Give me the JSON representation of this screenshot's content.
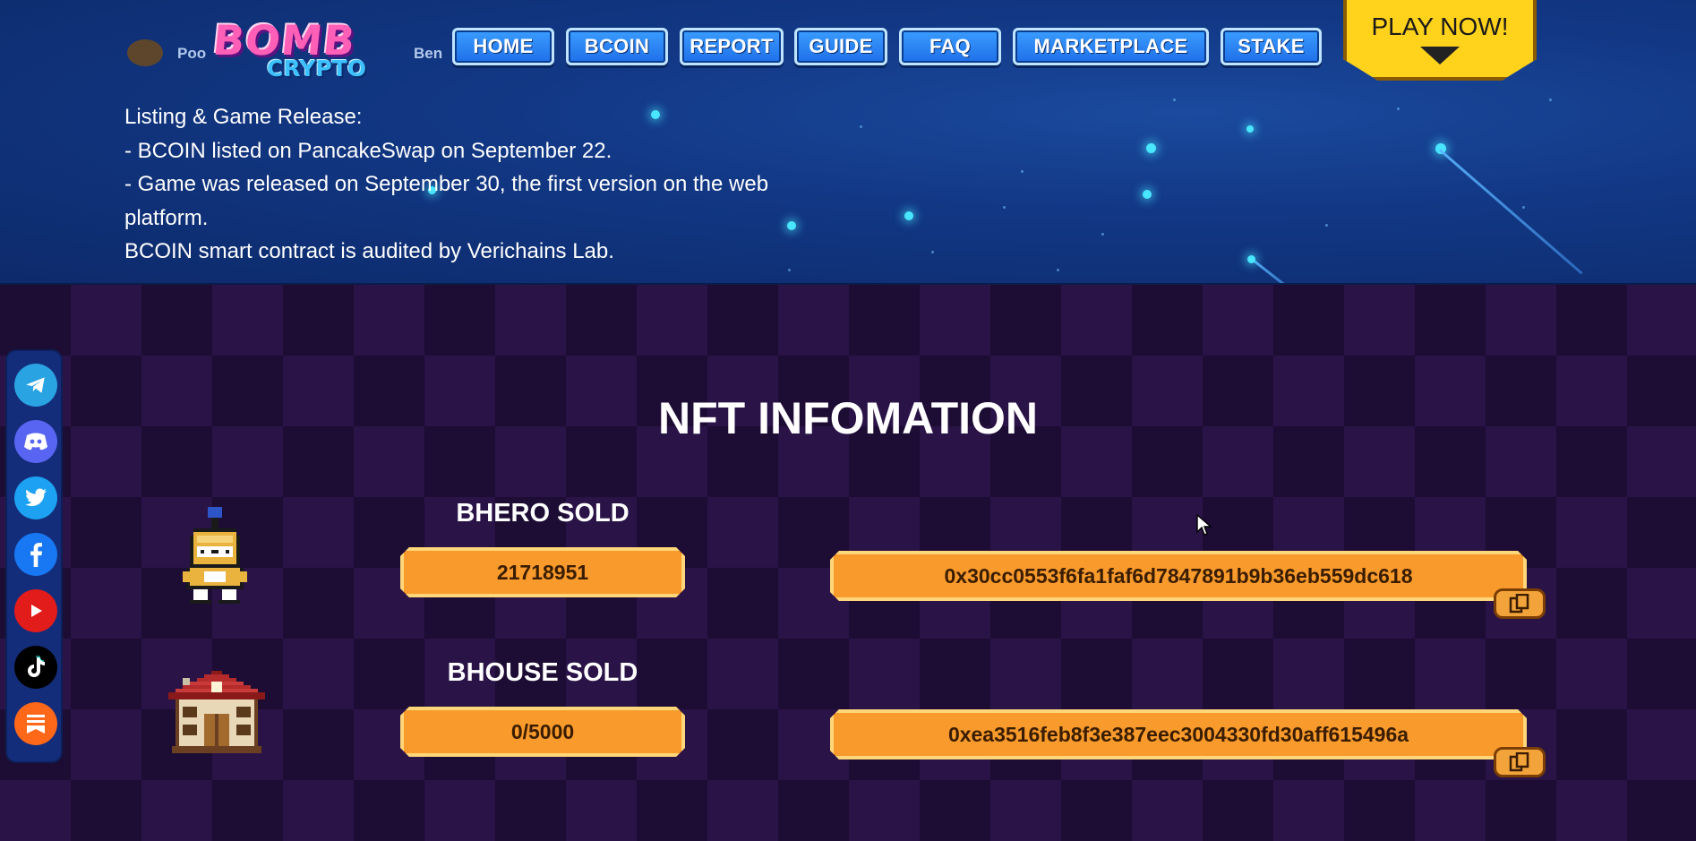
{
  "header": {
    "logo": {
      "line1": "BOMB",
      "line2": "CRYPTO"
    },
    "partial_behind_logo": [
      "Poo",
      "Ben"
    ],
    "nav": [
      "HOME",
      "BCOIN",
      "REPORT",
      "GUIDE",
      "FAQ",
      "MARKETPLACE",
      "STAKE"
    ],
    "play_now": "PLAY NOW!"
  },
  "release_info": {
    "lines": [
      "Listing & Game Release:",
      "- BCOIN listed on PancakeSwap on September 22.",
      "- Game was released on September 30, the first version on the web",
      "platform.",
      "BCOIN smart contract is audited by Verichains Lab."
    ]
  },
  "social": {
    "icons": [
      "telegram-icon",
      "discord-icon",
      "twitter-icon",
      "facebook-icon",
      "youtube-icon",
      "tiktok-icon",
      "substack-icon"
    ],
    "colors": [
      "#2aa3e3",
      "#5865f2",
      "#1da1f2",
      "#1877f2",
      "#e21b1b",
      "#000000",
      "#ff6719"
    ]
  },
  "nft_info": {
    "title": "NFT INFOMATION",
    "items": [
      {
        "label": "BHERO SOLD",
        "value": "21718951",
        "contract": "0x30cc0553f6fa1faf6d7847891b9b36eb559dc618",
        "icon": "knight-hero-icon"
      },
      {
        "label": "BHOUSE SOLD",
        "value": "0/5000",
        "contract": "0xea3516feb8f3e387eec3004330fd30aff615496a",
        "icon": "house-icon"
      }
    ]
  },
  "colors": {
    "nav_button": "#2a84f4",
    "pill_orange": "#f99a2c",
    "play_yellow": "#ffd21c",
    "checker_dark": "#1d0c34",
    "checker_light": "#2a1347",
    "star_blue": "#49e6ff"
  }
}
